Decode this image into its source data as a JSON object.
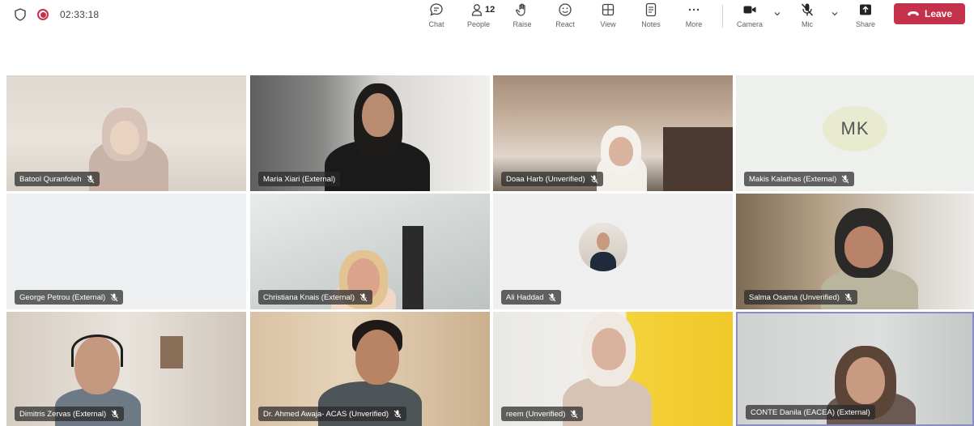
{
  "meeting": {
    "timer": "02:33:18"
  },
  "toolbar": {
    "chat": "Chat",
    "people": "People",
    "people_count": "12",
    "raise": "Raise",
    "react": "React",
    "view": "View",
    "notes": "Notes",
    "more": "More",
    "camera": "Camera",
    "mic": "Mic",
    "share": "Share",
    "leave": "Leave"
  },
  "participants": [
    {
      "name": "Batool Quranfoleh"
    },
    {
      "name": "Maria Xiari (External)"
    },
    {
      "name": "Doaa Harb (Unverified)"
    },
    {
      "name": "Makis Kalathas (External)",
      "initials": "MK"
    },
    {
      "name": "George Petrou (External)"
    },
    {
      "name": "Christiana Knais (External)"
    },
    {
      "name": "Ali Haddad"
    },
    {
      "name": "Salma Osama (Unverified)"
    },
    {
      "name": "Dimitris Zervas (External)"
    },
    {
      "name": "Dr. Ahmed Awaja- ACAS (Unverified)"
    },
    {
      "name": "reem (Unverified)"
    },
    {
      "name": "CONTE Danila (EACEA) (External)"
    }
  ],
  "colors": {
    "leave": "#c4314b",
    "recording": "#c4314b",
    "active_speaker": "#8b8cc7"
  }
}
